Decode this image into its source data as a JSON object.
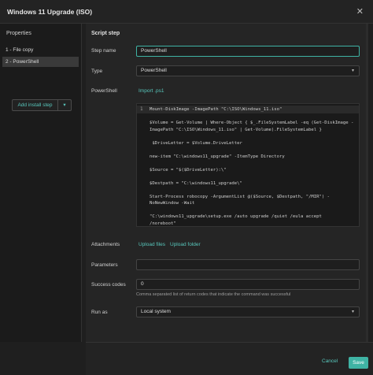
{
  "window": {
    "title": "Windows 11 Upgrade (ISO)",
    "close_glyph": "✕"
  },
  "sidebar": {
    "title": "Properties",
    "items": [
      {
        "label": "1 - File copy"
      },
      {
        "label": "2 - PowerShell"
      }
    ],
    "add_button": {
      "label": "Add install step",
      "caret": "▾"
    }
  },
  "form": {
    "section_title": "Script step",
    "step_name": {
      "label": "Step name",
      "value": "PowerShell"
    },
    "type": {
      "label": "Type",
      "value": "PowerShell",
      "arrow": "▾"
    },
    "powershell": {
      "label": "PowerShell",
      "import_link": "Import .ps1"
    },
    "code": {
      "line_number": "1",
      "lines": [
        "Mount-DiskImage -ImagePath \"C:\\ISO\\Windows_11.iso\"",
        "",
        "$Volume = Get-Volume | Where-Object { $_.FileSystemLabel -eq (Get-DiskImage -",
        "ImagePath \"C:\\ISO\\Windows_11.iso\" | Get-Volume).FileSystemLabel }",
        "",
        " $DriveLetter = $Volume.DriveLetter",
        "",
        "new-item \"C:\\windows11_upgrade\" -ItemType Directory",
        "",
        "$Source = \"$($DriveLetter):\\\"",
        "",
        "$Destpath = \"C:\\windows11_upgrade\\\"",
        "",
        "Start-Process robocopy -ArgumentList @($Source, $Destpath, \"/MIR\") -",
        "NoNewWindow -Wait",
        "",
        "\"C:\\windows11_upgrade\\setup.exe /auto upgrade /quiet /eula accept",
        "/noreboot\""
      ]
    },
    "attachments": {
      "label": "Attachments",
      "upload_files": "Upload files",
      "upload_folder": "Upload folder"
    },
    "parameters": {
      "label": "Parameters",
      "value": ""
    },
    "success_codes": {
      "label": "Success codes",
      "value": "0",
      "help": "Comma separated list of return codes that indicate the command was successful"
    },
    "run_as": {
      "label": "Run as",
      "value": "Local system",
      "arrow": "▾"
    }
  },
  "footer": {
    "cancel": "Cancel",
    "save": "Save"
  },
  "colors": {
    "accent": "#3fb3a4",
    "link": "#58c7bc",
    "background": "#252525"
  }
}
